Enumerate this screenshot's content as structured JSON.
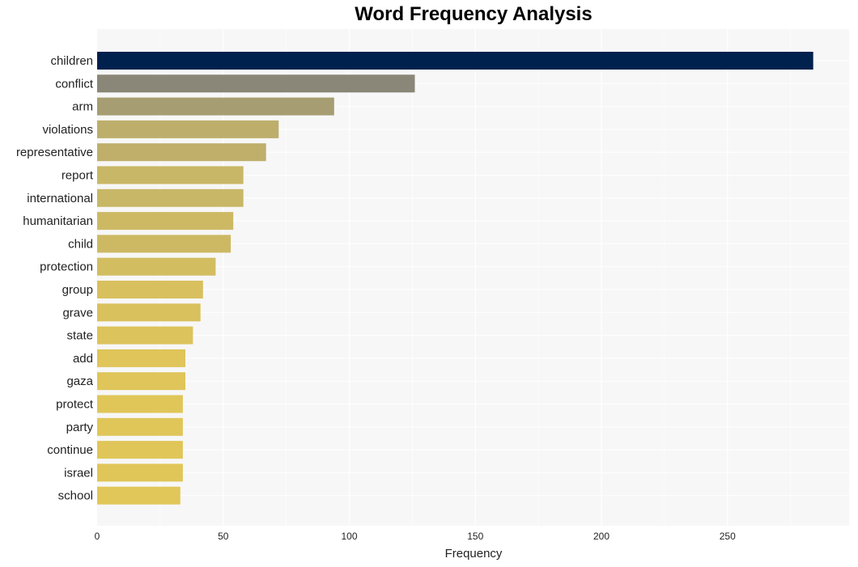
{
  "chart_data": {
    "type": "bar",
    "orientation": "horizontal",
    "title": "Word Frequency Analysis",
    "xlabel": "Frequency",
    "ylabel": "",
    "xlim": [
      0,
      298
    ],
    "xticks": [
      0,
      50,
      100,
      150,
      200,
      250
    ],
    "grid": true,
    "categories": [
      "children",
      "conflict",
      "arm",
      "violations",
      "representative",
      "report",
      "international",
      "humanitarian",
      "child",
      "protection",
      "group",
      "grave",
      "state",
      "add",
      "gaza",
      "protect",
      "party",
      "continue",
      "israel",
      "school"
    ],
    "values": [
      284,
      126,
      94,
      72,
      67,
      58,
      58,
      54,
      53,
      47,
      42,
      41,
      38,
      35,
      35,
      34,
      34,
      34,
      34,
      33
    ],
    "colors": [
      "#00204e",
      "#8a8678",
      "#a69d72",
      "#bdae6c",
      "#bfaf6b",
      "#c8b766",
      "#c8b766",
      "#cdb964",
      "#cdb964",
      "#d3bd61",
      "#d8c05e",
      "#d9c15e",
      "#dcc35c",
      "#dfc55a",
      "#dfc55a",
      "#e0c659",
      "#e0c659",
      "#e0c659",
      "#e0c659",
      "#e1c759"
    ]
  }
}
